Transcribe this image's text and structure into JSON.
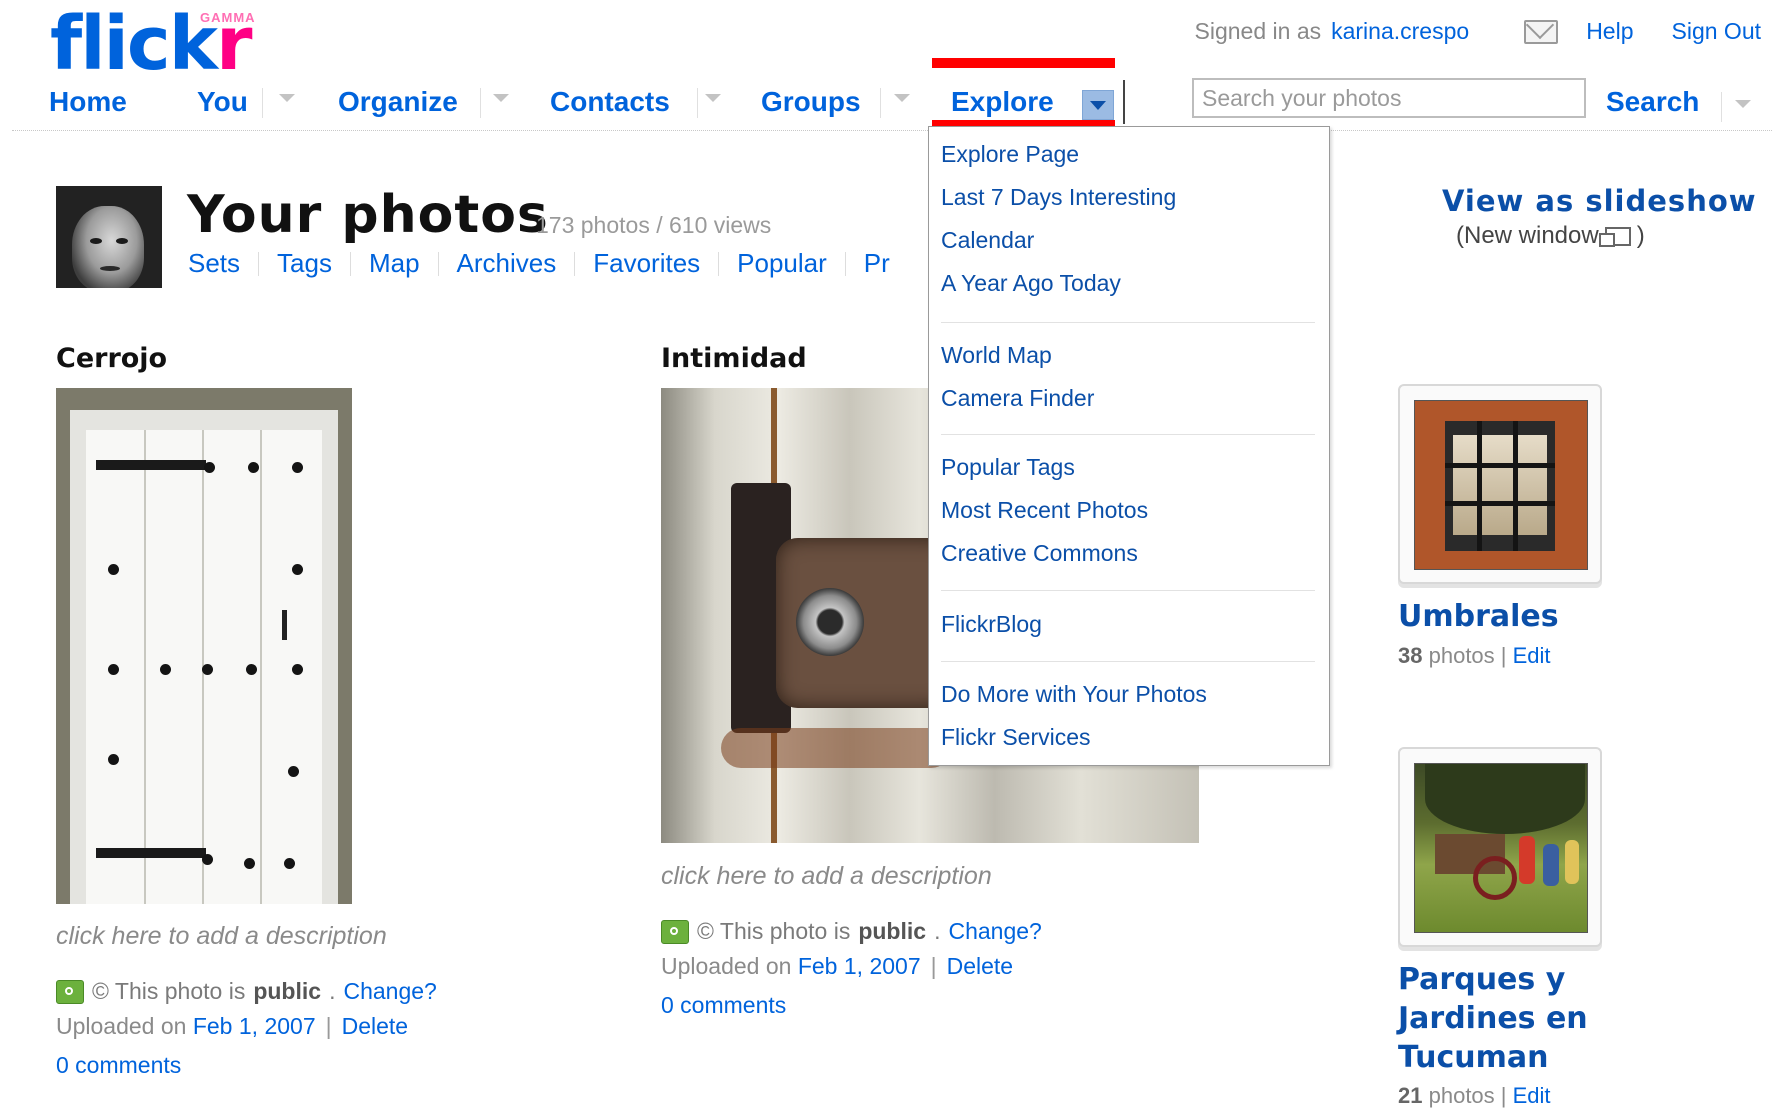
{
  "header": {
    "logo_main": "flick",
    "logo_accent": "r",
    "logo_badge": "GAMMA",
    "signed_in_prefix": "Signed in as",
    "username": "karina.crespo",
    "help": "Help",
    "sign_out": "Sign Out"
  },
  "nav": {
    "items": [
      "Home",
      "You",
      "Organize",
      "Contacts",
      "Groups",
      "Explore"
    ],
    "search_placeholder": "Search your photos",
    "search_label": "Search"
  },
  "explore_menu": {
    "groups": [
      [
        "Explore Page",
        "Last 7 Days Interesting",
        "Calendar",
        "A Year Ago Today"
      ],
      [
        "World Map",
        "Camera Finder"
      ],
      [
        "Popular Tags",
        "Most Recent Photos",
        "Creative Commons"
      ],
      [
        "FlickrBlog"
      ],
      [
        "Do More with Your Photos",
        "Flickr Services"
      ]
    ]
  },
  "profile": {
    "title": "Your photos",
    "stats": "173 photos / 610 views",
    "subnav": [
      "Sets",
      "Tags",
      "Map",
      "Archives",
      "Favorites",
      "Popular",
      "Pr"
    ]
  },
  "photos": [
    {
      "title": "Cerrojo",
      "description": "click here to add a description",
      "public_prefix": "© This photo is",
      "public_word": "public",
      "change": "Change?",
      "uploaded_prefix": "Uploaded on",
      "date": "Feb 1, 2007",
      "delete": "Delete",
      "comments": "0 comments"
    },
    {
      "title": "Intimidad",
      "description": "click here to add a description",
      "public_prefix": "© This photo is",
      "public_word": "public",
      "change": "Change?",
      "uploaded_prefix": "Uploaded on",
      "date": "Feb 1, 2007",
      "delete": "Delete",
      "comments": "0 comments"
    }
  ],
  "sidebar": {
    "slideshow": "View as slideshow",
    "new_window": "(New window",
    "new_window_close": ")",
    "sets": [
      {
        "title_lines": [
          "Umbrales"
        ],
        "count": "38",
        "count_label": "photos |",
        "edit": "Edit"
      },
      {
        "title_lines": [
          "Parques y",
          "Jardines en",
          "Tucuman"
        ],
        "count": "21",
        "count_label": "photos |",
        "edit": "Edit"
      }
    ]
  },
  "colors": {
    "link_blue": "#0063dc",
    "brand_pink": "#ff0084",
    "highlight_red": "#ff0000",
    "public_green": "#6cb13d"
  }
}
